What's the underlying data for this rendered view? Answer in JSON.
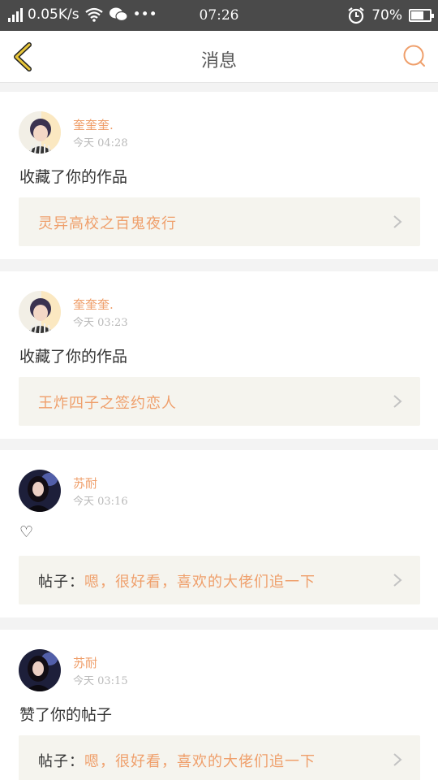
{
  "status_bar": {
    "speed": "0.05K/s",
    "dots": "•••",
    "time": "07:26",
    "battery_percent": "70%",
    "battery_level": 0.7
  },
  "header": {
    "title": "消息"
  },
  "colors": {
    "accent": "#ef9f6b",
    "reference_bg": "#f5f4ee",
    "back_arrow": "#e8c63a"
  },
  "messages": [
    {
      "user": "奎奎奎.",
      "time": "今天 04:28",
      "action": "收藏了你的作品",
      "reference_prefix": "",
      "reference": "灵异高校之百鬼夜行"
    },
    {
      "user": "奎奎奎.",
      "time": "今天 03:23",
      "action": "收藏了你的作品",
      "reference_prefix": "",
      "reference": "王炸四子之签约恋人"
    },
    {
      "user": "苏耐",
      "time": "今天 03:16",
      "action": "♡",
      "reference_prefix": "帖子：",
      "reference": "嗯，很好看，喜欢的大佬们追一下"
    },
    {
      "user": "苏耐",
      "time": "今天 03:15",
      "action": "赞了你的帖子",
      "reference_prefix": "帖子：",
      "reference": "嗯，很好看，喜欢的大佬们追一下"
    }
  ]
}
